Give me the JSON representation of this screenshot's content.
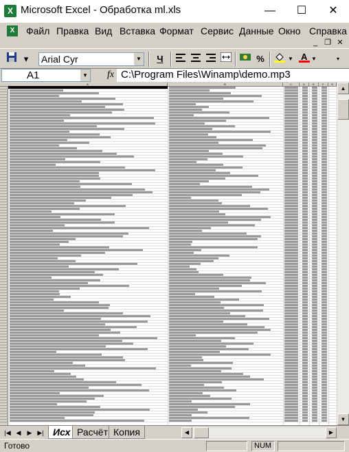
{
  "window": {
    "title": "Microsoft Excel - Обработка ml.xls",
    "app_icon": "X",
    "minimize_icon": "minimize-icon",
    "maximize_icon": "maximize-icon",
    "close_icon": "close-icon"
  },
  "menubar": {
    "items": [
      {
        "label": "Файл",
        "accel": "Ф"
      },
      {
        "label": "Правка",
        "accel": "П"
      },
      {
        "label": "Вид",
        "accel": "В"
      },
      {
        "label": "Вставка",
        "accel": "с"
      },
      {
        "label": "Формат",
        "accel": "Ф"
      },
      {
        "label": "Сервис",
        "accel": "С"
      },
      {
        "label": "Данные",
        "accel": "Д"
      },
      {
        "label": "Окно",
        "accel": "О"
      },
      {
        "label": "Справка",
        "accel": "С"
      }
    ]
  },
  "toolbar": {
    "font_name": "Arial Cyr",
    "underline_label": "Ч",
    "percent_label": "%",
    "icons": [
      "save-icon",
      "underline-icon",
      "align-left-icon",
      "align-center-icon",
      "align-right-icon",
      "merge-center-icon",
      "currency-icon",
      "percent-icon",
      "fill-color-icon",
      "font-color-icon"
    ],
    "fill_color": "#ffff00",
    "font_color": "#ff0000"
  },
  "formula_bar": {
    "cell_ref": "A1",
    "fx_label": "fx",
    "formula": "C:\\Program Files\\Winamp\\demo.mp3"
  },
  "sheet": {
    "column_headers": [
      "A",
      "B",
      "C",
      "D",
      "E",
      "F",
      "G"
    ],
    "row_count": 122
  },
  "sheet_tabs": [
    {
      "label": "Исх",
      "active": true
    },
    {
      "label": "Расчёт",
      "active": false
    },
    {
      "label": "Копия",
      "active": false
    }
  ],
  "status": {
    "ready": "Готово",
    "num": "NUM"
  }
}
